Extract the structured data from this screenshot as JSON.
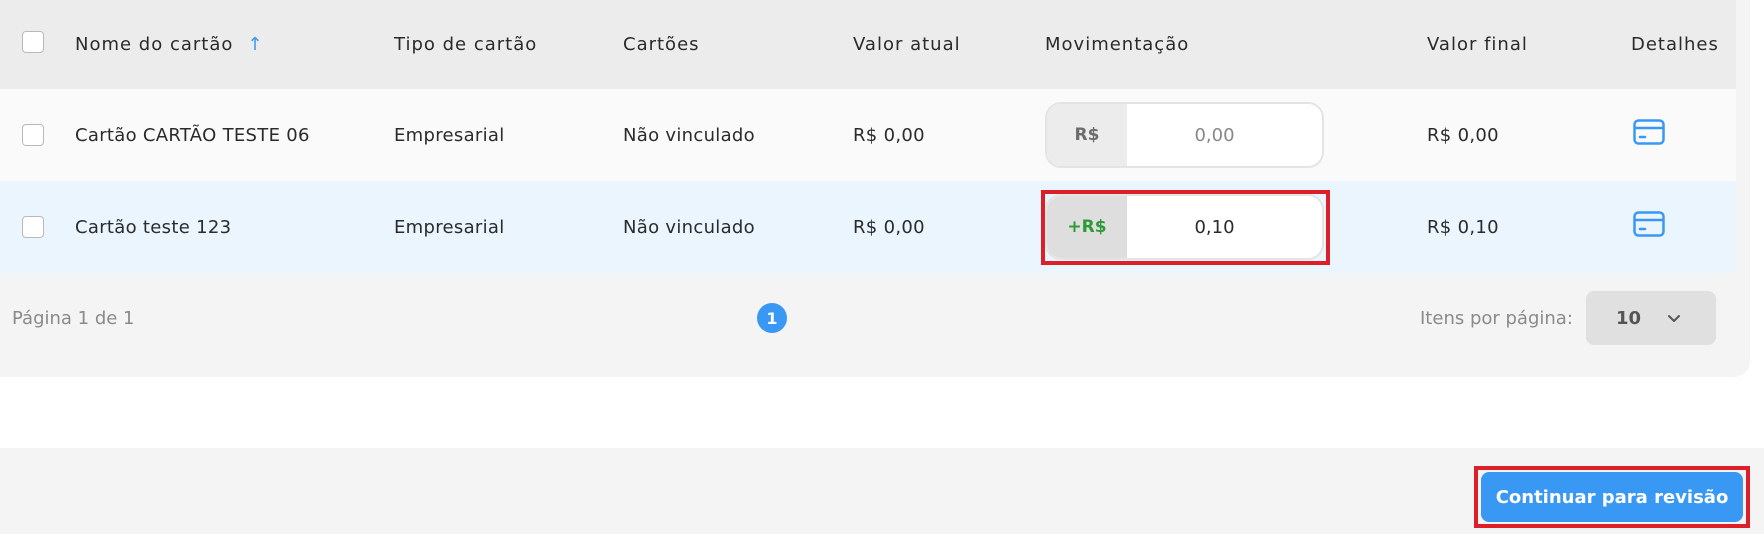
{
  "table": {
    "headers": {
      "nome": "Nome do cartão",
      "tipo": "Tipo de cartão",
      "cartoes": "Cartões",
      "valor_atual": "Valor atual",
      "movimentacao": "Movimentação",
      "valor_final": "Valor final",
      "detalhes": "Detalhes"
    },
    "sort_indicator": "↑",
    "rows": [
      {
        "nome": "Cartão CARTÃO TESTE 06",
        "tipo": "Empresarial",
        "cartoes": "Não vinculado",
        "valor_atual": "R$ 0,00",
        "mov_prefix": "R$",
        "mov_placeholder": "0,00",
        "mov_value": "",
        "valor_final": "R$ 0,00"
      },
      {
        "nome": "Cartão teste 123",
        "tipo": "Empresarial",
        "cartoes": "Não vinculado",
        "valor_atual": "R$ 0,00",
        "mov_prefix": "+R$",
        "mov_placeholder": "",
        "mov_value": "0,10",
        "valor_final": "R$ 0,10"
      }
    ]
  },
  "pagination": {
    "page_text": "Página 1 de 1",
    "current_page": "1",
    "items_per_page_label": "Itens por página:",
    "items_per_page_value": "10"
  },
  "actions": {
    "continue_label": "Continuar para revisão"
  },
  "colors": {
    "accent": "#3a98f5",
    "highlight": "#dc1f28",
    "positive": "#2c9a36",
    "selected_row": "#eaf5fe"
  },
  "icons": {
    "sort": "arrow-up-icon",
    "details": "card-icon",
    "select": "chevron-down-icon"
  }
}
